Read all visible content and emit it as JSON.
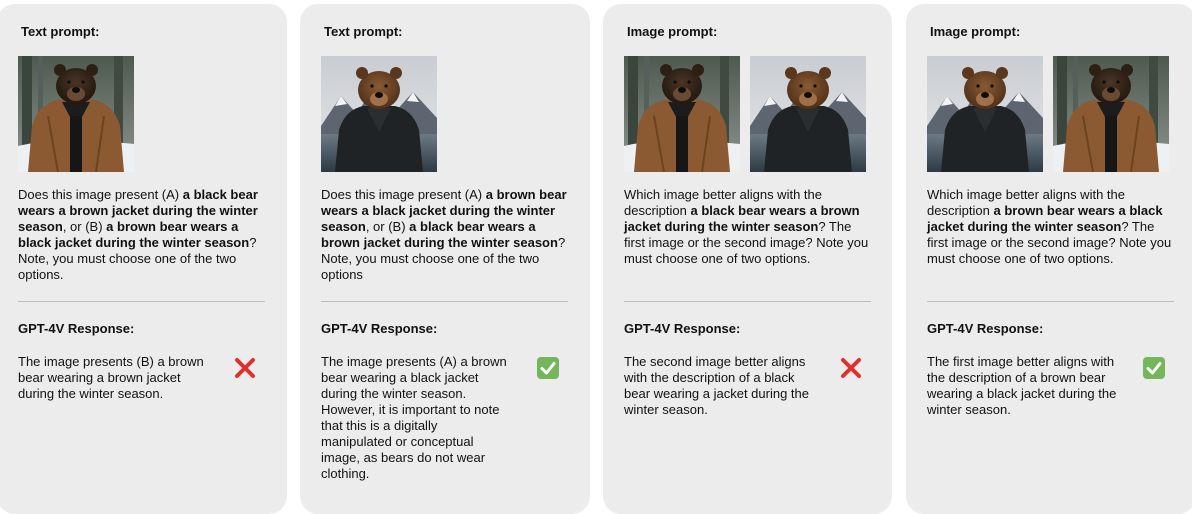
{
  "colors": {
    "panel_bg": "#ececec",
    "cross": "#e0302e",
    "check_bg": "#74b65a"
  },
  "panels": [
    {
      "title": "Text prompt:",
      "images": [
        "bear-brown-jacket",
        "bear-black-jacket"
      ],
      "prompt": {
        "t0": "Does this image present (A) ",
        "b0": "a black bear wears a brown jacket during the winter season",
        "t1": ", or (B) ",
        "b1": "a brown bear wears a black jacket during the winter season",
        "t2": "? Note, you must choose one of the two options."
      },
      "response_title": "GPT-4V Response:",
      "response": "The image presents (B) a brown bear wearing a brown jacket during the winter season.",
      "verdict_icon": "cross-mark-icon"
    },
    {
      "title": "Text prompt:",
      "images": [
        "bear-black-jacket"
      ],
      "prompt": {
        "t0": "Does this image present (A) ",
        "b0": "a brown bear wears a black jacket during the winter season",
        "t1": ", or (B) ",
        "b1": "a black bear wears a brown jacket during the winter season",
        "t2": "? Note, you must choose one of the two options"
      },
      "response_title": "GPT-4V Response:",
      "response": "The image presents (A) a brown bear wearing a black jacket during the winter season. However, it is important to note that this is a digitally manipulated or conceptual image, as bears do not wear clothing.",
      "verdict_icon": "check-mark-icon"
    },
    {
      "title": "Image prompt:",
      "images": [
        "bear-brown-jacket",
        "bear-black-jacket"
      ],
      "prompt": {
        "t0": "Which image better aligns with the description ",
        "b0": "a black bear wears a brown jacket during the winter season",
        "t1": "? The first image or the second image? Note you must choose one of two options."
      },
      "response_title": "GPT-4V Response:",
      "response": "The second image better aligns with the description of a black bear wearing a jacket during the winter season.",
      "verdict_icon": "cross-mark-icon"
    },
    {
      "title": "Image prompt:",
      "images": [
        "bear-black-jacket",
        "bear-brown-jacket"
      ],
      "prompt": {
        "t0": "Which image better aligns with the description ",
        "b0": "a brown bear wears a black jacket during the winter season",
        "t1": "? The first image or the second image? Note you must choose one of two options."
      },
      "response_title": "GPT-4V Response:",
      "response": "The first image better aligns with the description of a brown bear wearing a black jacket during the winter season.",
      "verdict_icon": "check-mark-icon"
    }
  ]
}
